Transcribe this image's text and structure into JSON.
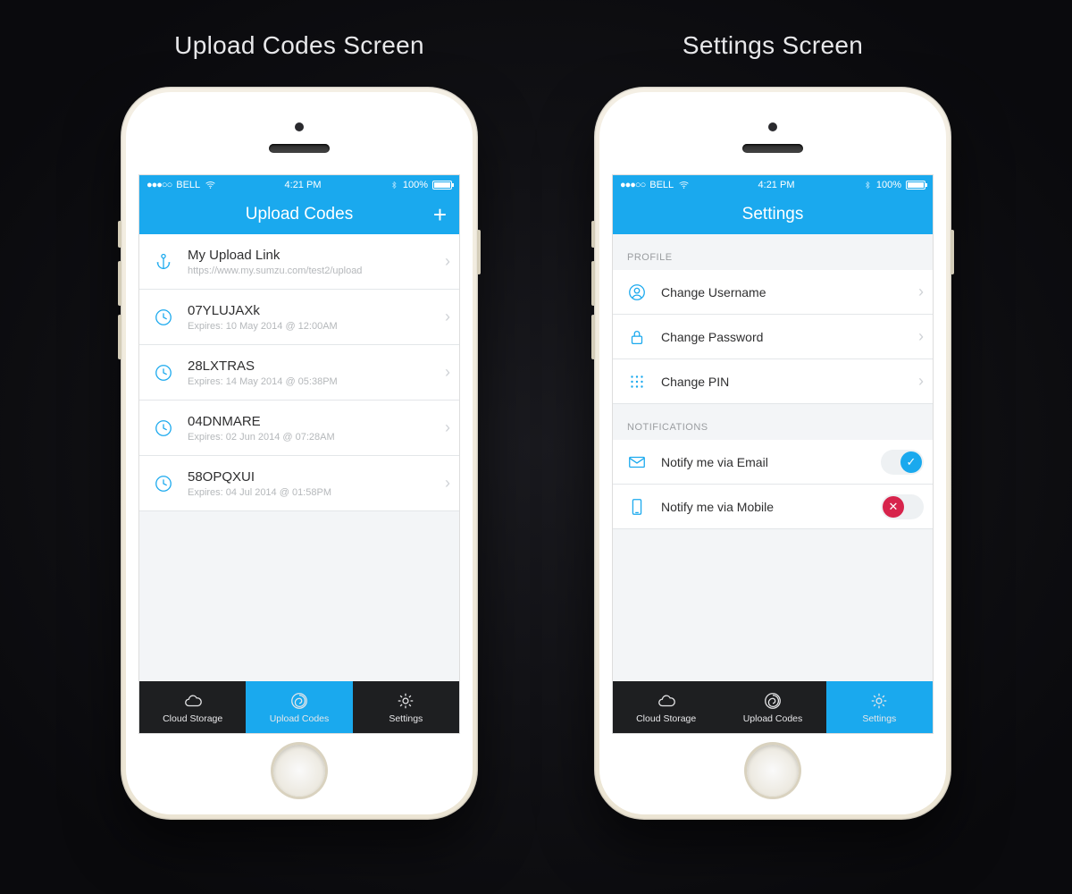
{
  "titles": {
    "left": "Upload Codes Screen",
    "right": "Settings Screen"
  },
  "status": {
    "carrier": "BELL",
    "dots": "●●●○○",
    "time": "4:21 PM",
    "pct": "100%"
  },
  "left": {
    "nav_title": "Upload Codes",
    "rows": [
      {
        "title": "My Upload Link",
        "sub": "https://www.my.sumzu.com/test2/upload"
      },
      {
        "title": "07YLUJAXk",
        "sub": "Expires: 10 May 2014 @ 12:00AM"
      },
      {
        "title": "28LXTRAS",
        "sub": "Expires: 14 May 2014 @ 05:38PM"
      },
      {
        "title": "04DNMARE",
        "sub": "Expires: 02 Jun 2014 @ 07:28AM"
      },
      {
        "title": "58OPQXUI",
        "sub": "Expires: 04 Jul 2014 @ 01:58PM"
      }
    ]
  },
  "right": {
    "nav_title": "Settings",
    "section_profile": "PROFILE",
    "profile_rows": [
      {
        "label": "Change Username"
      },
      {
        "label": "Change Password"
      },
      {
        "label": "Change PIN"
      }
    ],
    "section_notif": "NOTIFICATIONS",
    "notif_rows": [
      {
        "label": "Notify me via Email"
      },
      {
        "label": "Notify me via Mobile"
      }
    ]
  },
  "tabs": {
    "cloud": "Cloud Storage",
    "codes": "Upload Codes",
    "settings": "Settings"
  }
}
